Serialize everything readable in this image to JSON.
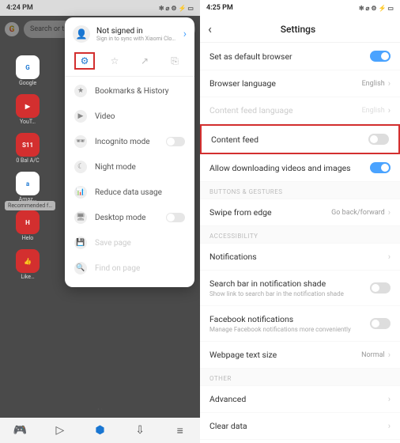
{
  "left": {
    "time": "4:24 PM",
    "status_icons": "✻ ⌀ ⚙ ⚡ ▭",
    "search_placeholder": "Search or t…",
    "apps": [
      {
        "icon": "G",
        "label": "Google"
      },
      {
        "icon": "▶",
        "label": "YouT…"
      },
      {
        "icon": "S11",
        "label": "0 Bal A/C"
      },
      {
        "icon": "a",
        "label": "Amaz…"
      },
      {
        "icon": "H",
        "label": "Helo"
      },
      {
        "icon": "👍",
        "label": "Like…"
      }
    ],
    "recommended": "Recommended f…",
    "menu": {
      "signin_title": "Not signed in",
      "signin_sub": "Sign in to sync with Xiaomi Clo…",
      "items": [
        {
          "label": "Bookmarks & History"
        },
        {
          "label": "Video"
        },
        {
          "label": "Incognito mode",
          "toggle": true
        },
        {
          "label": "Night mode"
        },
        {
          "label": "Reduce data usage"
        },
        {
          "label": "Desktop mode",
          "toggle": true
        },
        {
          "label": "Save page",
          "disabled": true
        },
        {
          "label": "Find on page",
          "disabled": true
        }
      ]
    }
  },
  "right": {
    "time": "4:25 PM",
    "status_icons": "✻ ⌀ ⚙ ⚡ ▭",
    "title": "Settings",
    "rows": [
      {
        "type": "toggle",
        "label": "Set as default browser",
        "on": true
      },
      {
        "type": "nav",
        "label": "Browser language",
        "value": "English"
      },
      {
        "type": "nav",
        "label": "Content feed language",
        "value": "English",
        "disabled": true
      },
      {
        "type": "toggle",
        "label": "Content feed",
        "on": false,
        "highlight": true
      },
      {
        "type": "toggle",
        "label": "Allow downloading videos and images",
        "on": true
      },
      {
        "type": "header",
        "label": "BUTTONS & GESTURES"
      },
      {
        "type": "nav",
        "label": "Swipe from edge",
        "value": "Go back/forward"
      },
      {
        "type": "header",
        "label": "ACCESSIBILITY"
      },
      {
        "type": "nav",
        "label": "Notifications"
      },
      {
        "type": "toggle",
        "label": "Search bar in notification shade",
        "sub": "Show link to search bar in the notification shade",
        "on": false
      },
      {
        "type": "toggle",
        "label": "Facebook notifications",
        "sub": "Manage Facebook notifications more conveniently",
        "on": false
      },
      {
        "type": "nav",
        "label": "Webpage text size",
        "value": "Normal"
      },
      {
        "type": "header",
        "label": "OTHER"
      },
      {
        "type": "nav",
        "label": "Advanced"
      },
      {
        "type": "nav",
        "label": "Clear data"
      }
    ]
  }
}
